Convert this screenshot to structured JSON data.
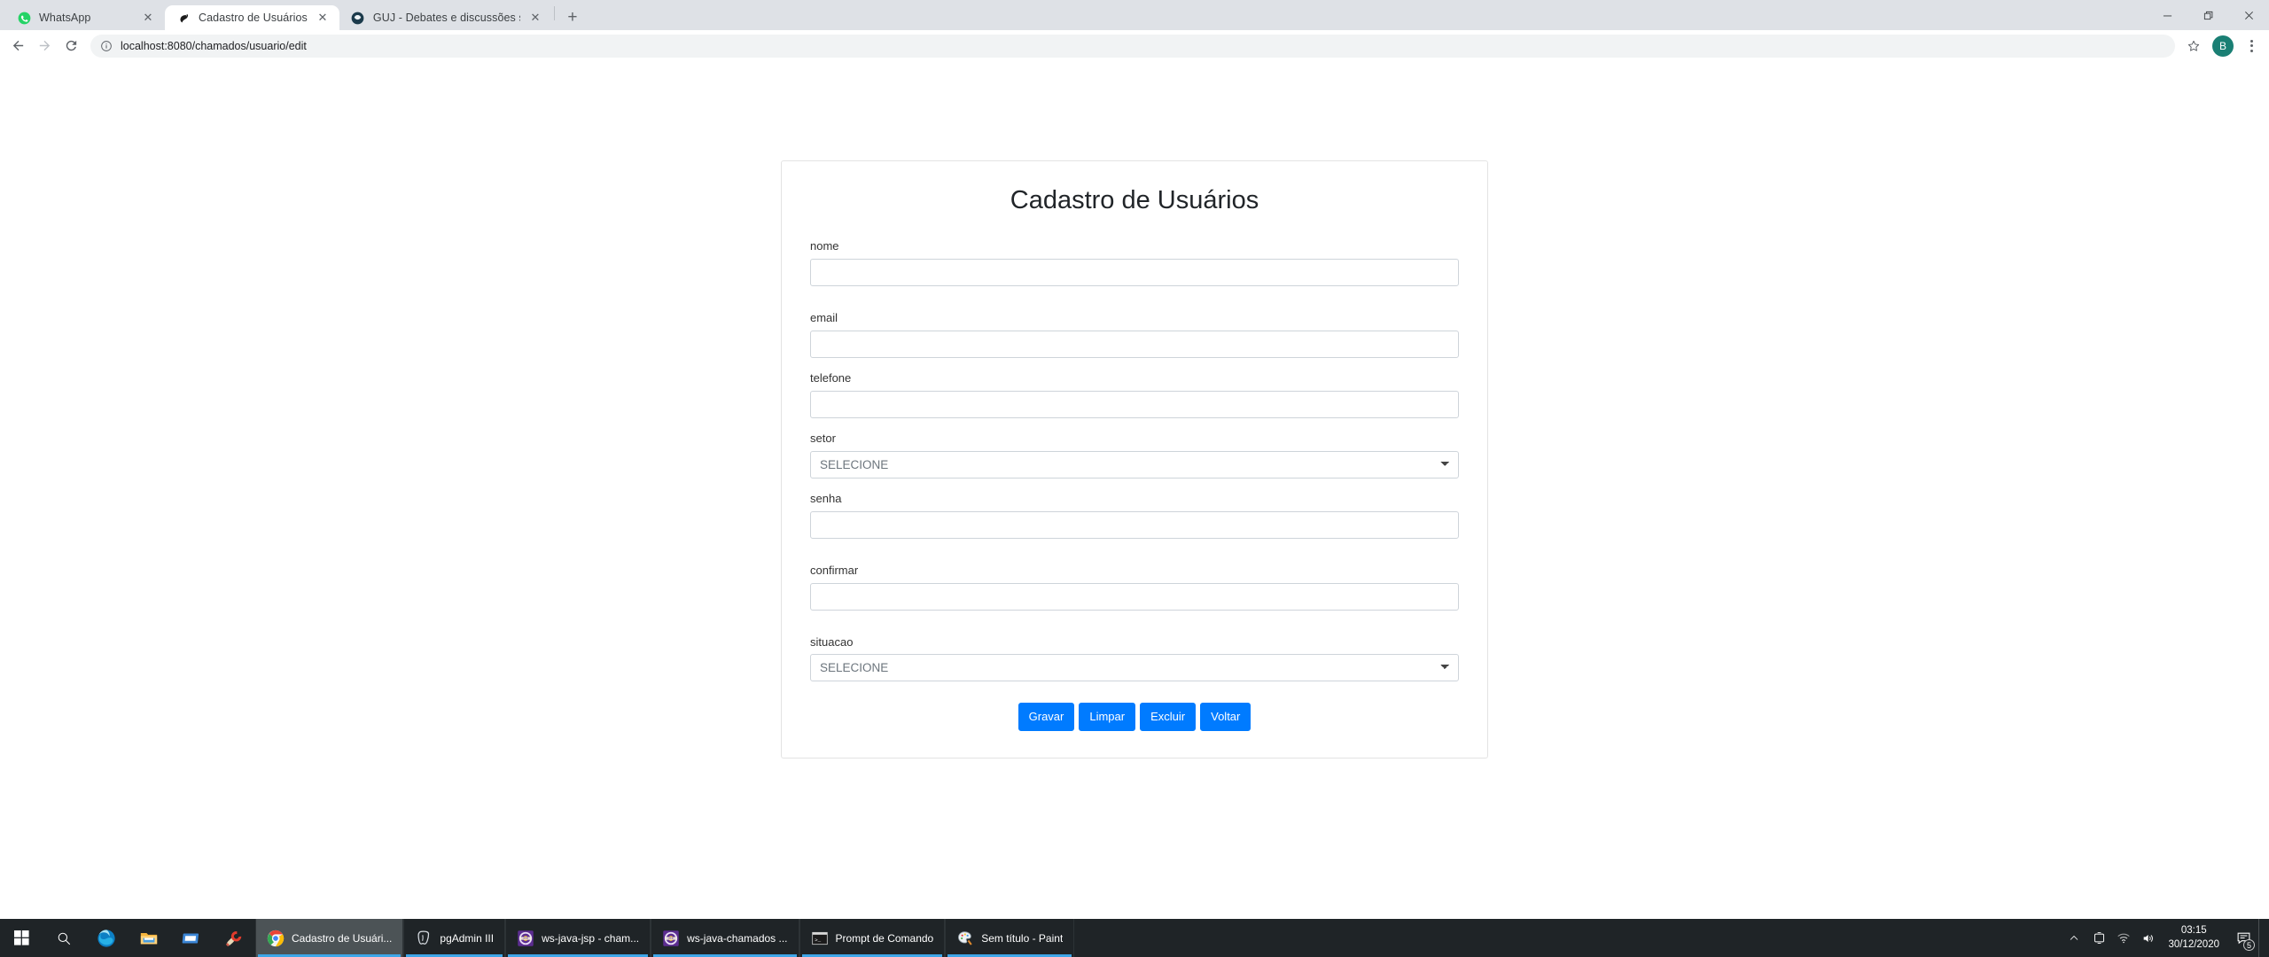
{
  "browser": {
    "tabs": [
      {
        "title": "WhatsApp",
        "favicon": "whatsapp-icon",
        "active": false,
        "close_label": "✕"
      },
      {
        "title": "Cadastro de Usuários",
        "favicon": "spring-bird-icon",
        "active": true,
        "close_label": "✕"
      },
      {
        "title": "GUJ - Debates e discussões sobre",
        "favicon": "guj-icon",
        "active": false,
        "close_label": "✕"
      }
    ],
    "new_tab_label": "+",
    "window_controls": {
      "minimize": "—",
      "restore": "❐",
      "close": "✕"
    },
    "toolbar": {
      "back_label": "←",
      "forward_label": "→",
      "reload_label": "⟳",
      "site_info_icon": "info-circle-icon",
      "url_scheme_host": "localhost:8080",
      "url_path": "/chamados/usuario/edit",
      "url_full": "localhost:8080/chamados/usuario/edit",
      "bookmark_label": "☆",
      "profile_initial": "B",
      "menu_label": "⋮"
    }
  },
  "page": {
    "title": "Cadastro de Usuários",
    "fields": [
      {
        "label": "nome",
        "type": "text",
        "value": "",
        "name": "nome"
      },
      {
        "label": "email",
        "type": "text",
        "value": "",
        "name": "email"
      },
      {
        "label": "telefone",
        "type": "text",
        "value": "",
        "name": "telefone"
      },
      {
        "label": "setor",
        "type": "select",
        "value": "SELECIONE",
        "name": "setor"
      },
      {
        "label": "senha",
        "type": "password",
        "value": "",
        "name": "senha"
      },
      {
        "label": "confirmar",
        "type": "password",
        "value": "",
        "name": "confirmar"
      },
      {
        "label": "situacao",
        "type": "select",
        "value": "SELECIONE",
        "name": "situacao"
      }
    ],
    "select_placeholder": "SELECIONE",
    "buttons": [
      {
        "label": "Gravar",
        "name": "gravar-button"
      },
      {
        "label": "Limpar",
        "name": "limpar-button"
      },
      {
        "label": "Excluir",
        "name": "excluir-button"
      },
      {
        "label": "Voltar",
        "name": "voltar-button"
      }
    ],
    "colors": {
      "primary": "#007bff",
      "card_border": "#e3e3e3",
      "input_border": "#ced4da"
    }
  },
  "taskbar": {
    "start_label": "start-icon",
    "search_label": "search-icon",
    "pinned": [
      {
        "name": "edge-icon"
      },
      {
        "name": "file-explorer-icon"
      },
      {
        "name": "mail-icon"
      },
      {
        "name": "ccleaner-icon"
      }
    ],
    "windows": [
      {
        "label": "Cadastro de Usuári...",
        "icon": "chrome-icon",
        "active": true
      },
      {
        "label": "pgAdmin III",
        "icon": "pgadmin-icon",
        "active": false
      },
      {
        "label": "ws-java-jsp - cham...",
        "icon": "eclipse-icon",
        "active": false
      },
      {
        "label": "ws-java-chamados ...",
        "icon": "eclipse-icon",
        "active": false
      },
      {
        "label": "Prompt de Comando",
        "icon": "cmd-icon",
        "active": false
      },
      {
        "label": "Sem título - Paint",
        "icon": "paint-icon",
        "active": false
      }
    ],
    "tray": {
      "chevron_label": "∧",
      "icons": [
        "onedrive-icon",
        "wifi-icon",
        "volume-icon"
      ],
      "time": "03:15",
      "date": "30/12/2020",
      "notification_count": "5"
    }
  }
}
